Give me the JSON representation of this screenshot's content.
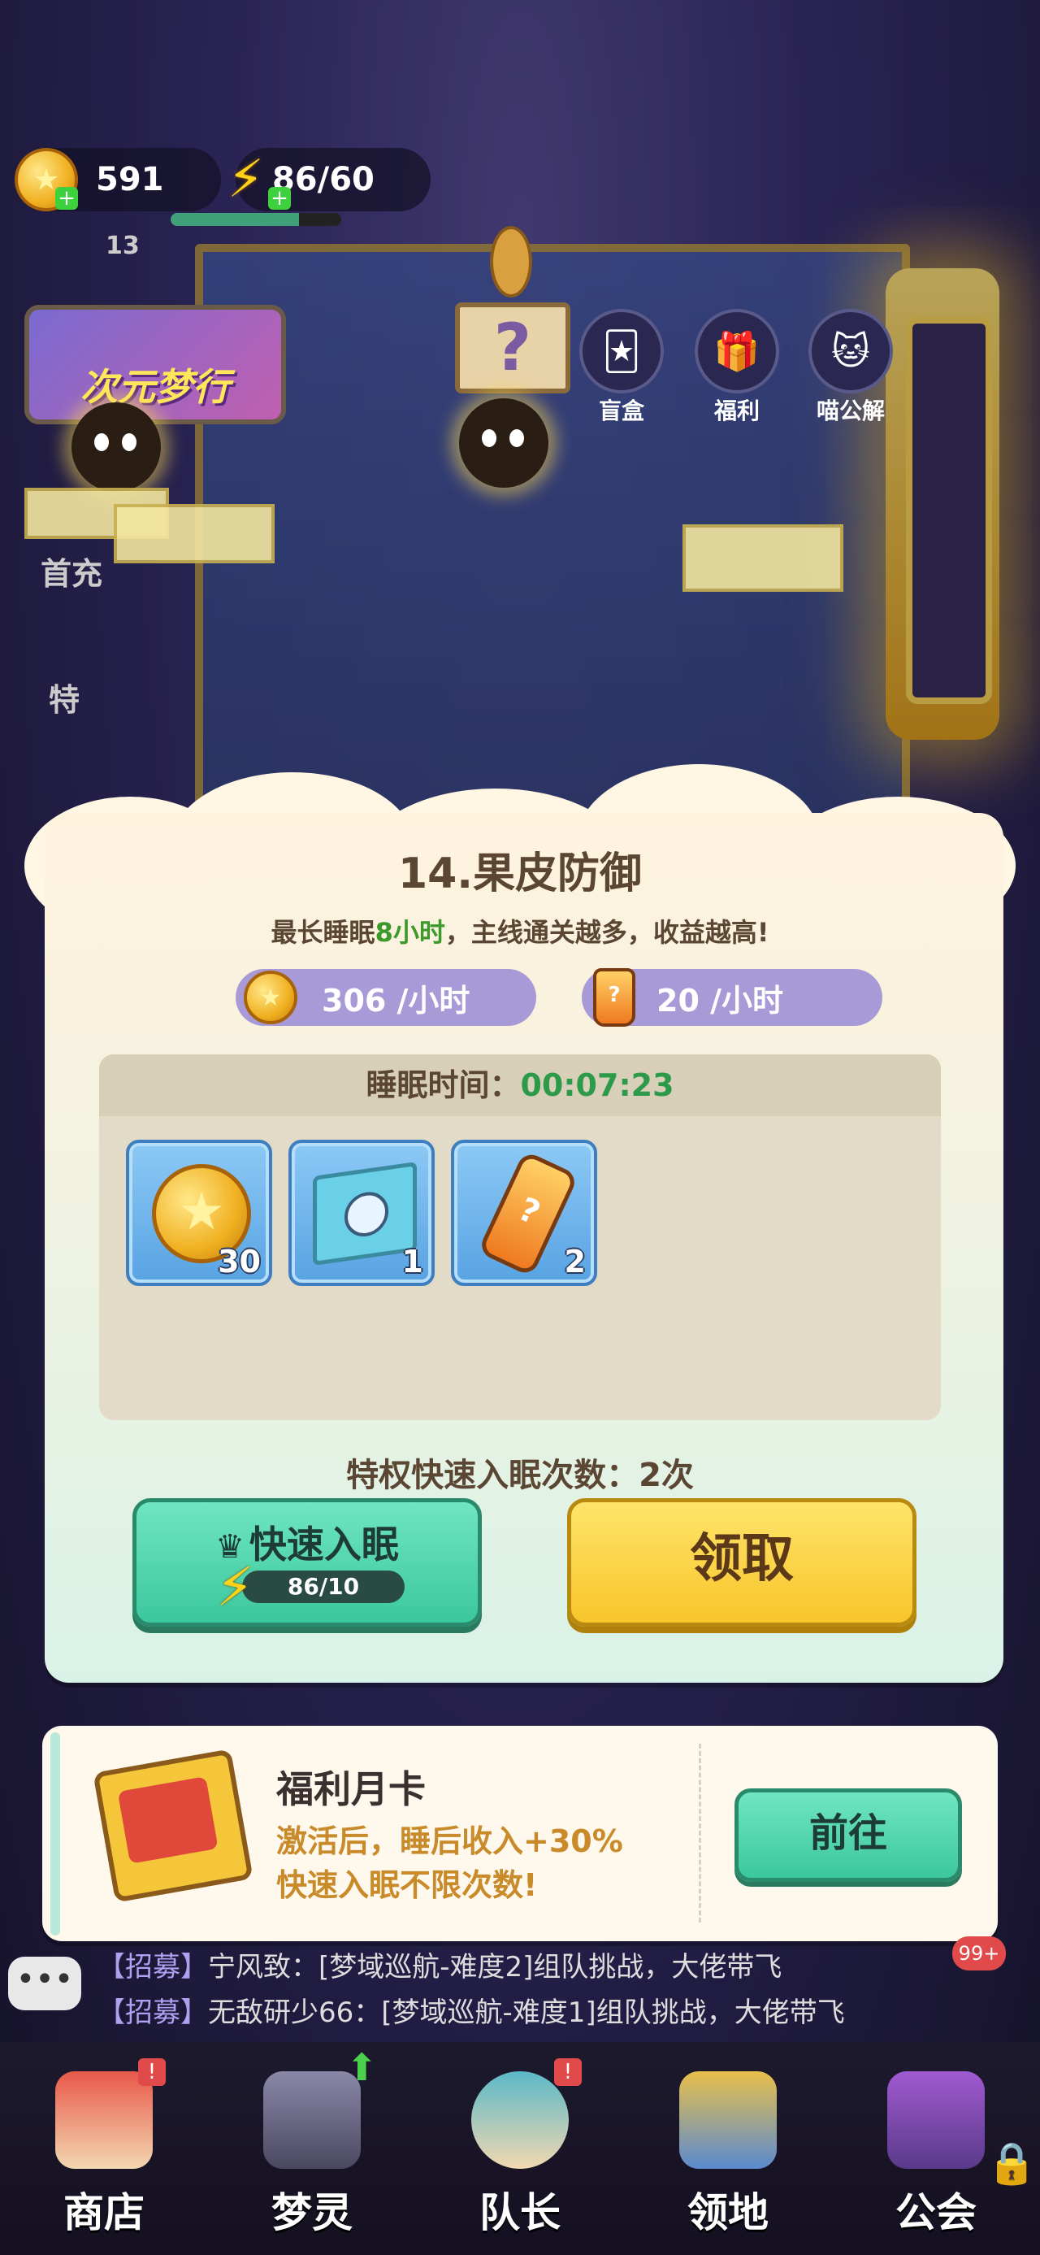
{
  "top_bar": {
    "coins": "591",
    "energy": "86/60",
    "level": "13",
    "coin_icon": "gold-coin-icon",
    "energy_icon": "lightning-icon"
  },
  "event_banner": {
    "label": "次元梦行"
  },
  "top_icons": [
    {
      "label": "盲盒",
      "icon": "blind-box-icon"
    },
    {
      "label": "福利",
      "icon": "gift-icon"
    },
    {
      "label": "喵公解",
      "icon": "cat-icon"
    }
  ],
  "side_labels": {
    "first_charge": "首充",
    "special": "特"
  },
  "sleep_panel": {
    "title": "14.果皮防御",
    "subtitle_prefix": "最长睡眠",
    "subtitle_hours": "8小时",
    "subtitle_suffix": "，主线通关越多，收益越高!",
    "coin_rate": "306 /小时",
    "drink_rate": "20 /小时",
    "sleep_time_label": "睡眠时间：",
    "sleep_time": "00:07:23",
    "rewards": [
      {
        "icon": "gold-coin-icon",
        "count": "30"
      },
      {
        "icon": "map-icon",
        "count": "1"
      },
      {
        "icon": "bottle-icon",
        "count": "2"
      }
    ],
    "privilege_text": "特权快速入眠次数：2次",
    "fast_sleep_label": "快速入眠",
    "fast_sleep_cost": "86/10",
    "claim_label": "领取"
  },
  "monthly_card": {
    "title": "福利月卡",
    "desc_line1": "激活后，睡后收入+30%",
    "desc_line2": "快速入眠不限次数!",
    "button": "前往"
  },
  "chat": {
    "messages": [
      {
        "tag": "【招募】",
        "text": "宁风致：[梦域巡航-难度2]组队挑战，大佬带飞"
      },
      {
        "tag": "【招募】",
        "text": "无敌研少66：[梦域巡航-难度1]组队挑战，大佬带飞"
      }
    ],
    "badge": "99+"
  },
  "nav": [
    {
      "label": "商店",
      "icon": "shop-icon",
      "badge": "!"
    },
    {
      "label": "梦灵",
      "icon": "dream-spirit-icon",
      "badge": "up"
    },
    {
      "label": "队长",
      "icon": "captain-icon",
      "badge": "!"
    },
    {
      "label": "领地",
      "icon": "territory-icon",
      "badge": ""
    },
    {
      "label": "公会",
      "icon": "guild-icon",
      "badge": "lock"
    }
  ],
  "colors": {
    "accent_green": "#3cc79c",
    "claim_yellow": "#f7c52a",
    "pill_purple": "#a89ad6",
    "time_green": "#2d9a4a"
  }
}
